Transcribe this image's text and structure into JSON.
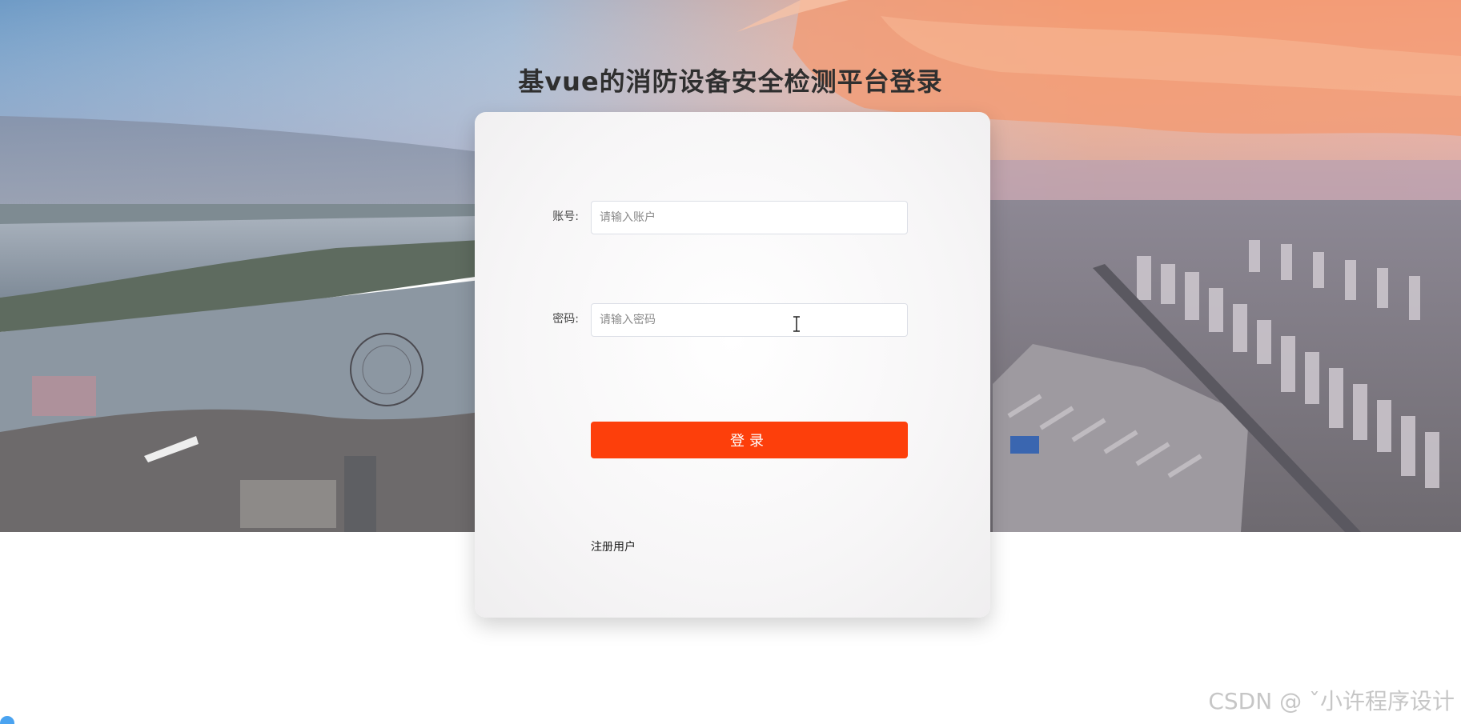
{
  "page": {
    "title": "基vue的消防设备安全检测平台登录"
  },
  "login_form": {
    "account_label": "账号:",
    "account_placeholder": "请输入账户",
    "account_value": "",
    "password_label": "密码:",
    "password_placeholder": "请输入密码",
    "password_value": "",
    "submit_label": "登录",
    "register_link": "注册用户"
  },
  "watermark": {
    "text": "CSDN @ ˇ小许程序设计"
  },
  "colors": {
    "primary_button": "#fd3f0b",
    "title_text": "#2f2f2f",
    "card_background": "#f7f6f7"
  },
  "icons": {
    "text_cursor": "text-cursor-icon",
    "corner_indicator": "status-dot-icon"
  }
}
